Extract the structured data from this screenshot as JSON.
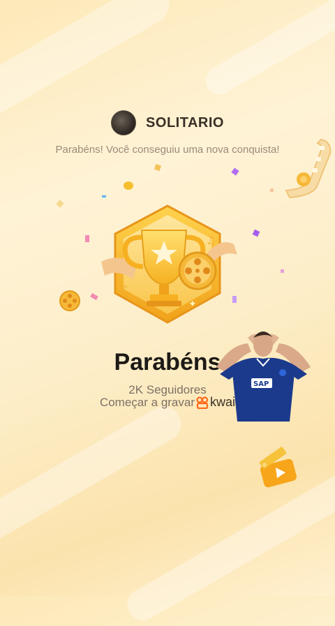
{
  "header": {
    "avatar_icon": "user-avatar-icon",
    "username": "SOLITARIO"
  },
  "subtitle": "Parabéns! Você conseguiu uma nova conquista!",
  "badge": {
    "icon": "trophy-badge-icon",
    "accent": "#f7b722"
  },
  "main": {
    "title": "Parabéns",
    "followers": "2K Seguidores",
    "cta_text": "Começar a gravar",
    "brand": "kwai",
    "brand_color": "#ff6a1a"
  },
  "decorations": {
    "film_strip_icon": "film-strip-icon",
    "clapperboard_icon": "clapperboard-icon",
    "film_reel_icon": "film-reel-icon"
  }
}
